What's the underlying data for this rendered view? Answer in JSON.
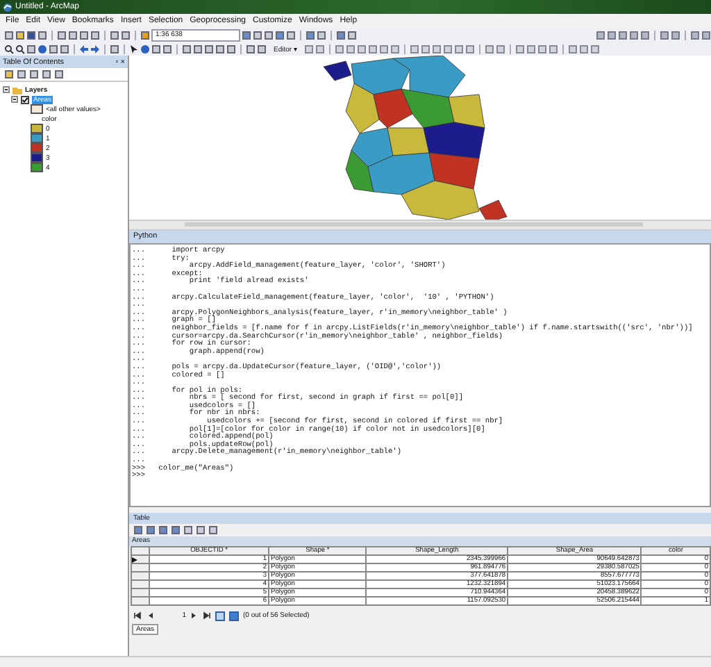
{
  "window": {
    "title": "Untitled - ArcMap"
  },
  "menu": [
    "File",
    "Edit",
    "View",
    "Bookmarks",
    "Insert",
    "Selection",
    "Geoprocessing",
    "Customize",
    "Windows",
    "Help"
  ],
  "toolbar": {
    "scale": "1:36 638",
    "editor_label": "Editor ▾"
  },
  "toc": {
    "title": "Table Of Contents",
    "pin": "▫ ×",
    "root": {
      "label": "Layers",
      "expanded": true,
      "children": [
        {
          "label": "Areas",
          "selected": true,
          "checked": true,
          "expanded": true
        }
      ]
    },
    "other_values": "<all other values>",
    "field": "color",
    "legend": [
      {
        "label": "0",
        "color": "#c8b83c"
      },
      {
        "label": "1",
        "color": "#3a9cc4"
      },
      {
        "label": "2",
        "color": "#c03222"
      },
      {
        "label": "3",
        "color": "#1c1c8c"
      },
      {
        "label": "4",
        "color": "#3c9a32"
      }
    ]
  },
  "python": {
    "title": "Python",
    "lines": [
      {
        "prompt": "...",
        "text": "    import arcpy"
      },
      {
        "prompt": "...",
        "text": "    try:"
      },
      {
        "prompt": "...",
        "text": "        arcpy.AddField_management(feature_layer, 'color', 'SHORT')"
      },
      {
        "prompt": "...",
        "text": "    except:"
      },
      {
        "prompt": "...",
        "text": "        print 'field alread exists'"
      },
      {
        "prompt": "..."
      },
      {
        "prompt": "...",
        "text": "    arcpy.CalculateField_management(feature_layer, 'color',  '10' , 'PYTHON')"
      },
      {
        "prompt": "..."
      },
      {
        "prompt": "...",
        "text": "    arcpy.PolygonNeighbors_analysis(feature_layer, r'in_memory\\neighbor_table' )"
      },
      {
        "prompt": "...",
        "text": "    graph = []"
      },
      {
        "prompt": "...",
        "text": "    neighbor_fields = [f.name for f in arcpy.ListFields(r'in_memory\\neighbor_table') if f.name.startswith(('src', 'nbr'))]"
      },
      {
        "prompt": "...",
        "text": "    cursor=arcpy.da.SearchCursor(r'in_memory\\neighbor_table' , neighbor_fields)"
      },
      {
        "prompt": "...",
        "text": "    for row in cursor:"
      },
      {
        "prompt": "...",
        "text": "        graph.append(row)"
      },
      {
        "prompt": "..."
      },
      {
        "prompt": "...",
        "text": "    pols = arcpy.da.UpdateCursor(feature_layer, ('OID@','color'))"
      },
      {
        "prompt": "...",
        "text": "    colored = []"
      },
      {
        "prompt": "..."
      },
      {
        "prompt": "...",
        "text": "    for pol in pols:"
      },
      {
        "prompt": "...",
        "text": "        nbrs = [ second for first, second in graph if first == pol[0]]"
      },
      {
        "prompt": "...",
        "text": "        usedcolors = []"
      },
      {
        "prompt": "...",
        "text": "        for nbr in nbrs:"
      },
      {
        "prompt": "...",
        "text": "            usedcolors += [second for first, second in colored if first == nbr]"
      },
      {
        "prompt": "...",
        "text": "        pol[1]=[color for color in range(10) if color not in usedcolors][0]"
      },
      {
        "prompt": "...",
        "text": "        colored.append(pol)"
      },
      {
        "prompt": "...",
        "text": "        pols.updateRow(pol)"
      },
      {
        "prompt": "...",
        "text": "    arcpy.Delete_management(r'in_memory\\neighbor_table')"
      },
      {
        "prompt": "..."
      },
      {
        "prompt": ">>>",
        "text": " color_me(\"Areas\")"
      },
      {
        "prompt": ">>>"
      }
    ]
  },
  "table": {
    "title": "Table",
    "tab_title": "Areas",
    "columns": [
      "OBJECTID *",
      "Shape *",
      "Shape_Length",
      "Shape_Area",
      "color"
    ],
    "rows": [
      {
        "current": true,
        "cells": [
          "1",
          "Polygon",
          "2345.399966",
          "90649.642873",
          "0"
        ]
      },
      {
        "current": false,
        "cells": [
          "2",
          "Polygon",
          "961.894776",
          "29380.587025",
          "0"
        ]
      },
      {
        "current": false,
        "cells": [
          "3",
          "Polygon",
          "377.641878",
          "8557.677773",
          "0"
        ]
      },
      {
        "current": false,
        "cells": [
          "4",
          "Polygon",
          "1232.321894",
          "51023.175664",
          "0"
        ]
      },
      {
        "current": false,
        "cells": [
          "5",
          "Polygon",
          "710.944364",
          "20458.389622",
          "0"
        ]
      },
      {
        "current": false,
        "cells": [
          "6",
          "Polygon",
          "1157.092530",
          "52506.215444",
          "1"
        ]
      }
    ],
    "record": "1",
    "selection": "(0 out of 56 Selected)",
    "bottom_tab": "Areas"
  }
}
